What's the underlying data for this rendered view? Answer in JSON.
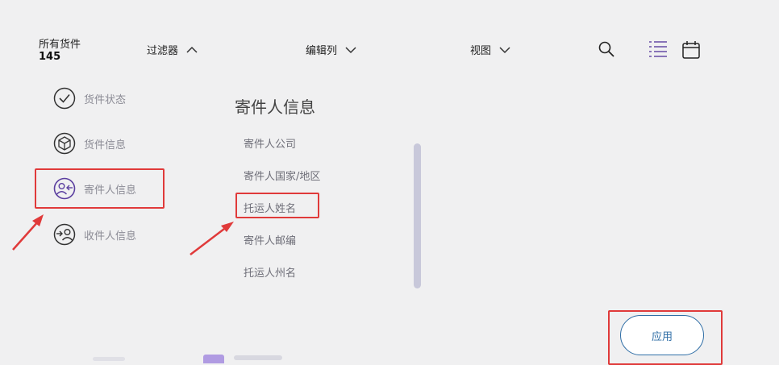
{
  "header": {
    "count_label": "所有货件",
    "count_value": "145",
    "filter_label": "过滤器",
    "edit_columns_label": "编辑列",
    "view_label": "视图"
  },
  "categories": [
    {
      "label": "货件状态",
      "icon": "check-circle-icon"
    },
    {
      "label": "货件信息",
      "icon": "box-icon"
    },
    {
      "label": "寄件人信息",
      "icon": "sender-user-icon"
    },
    {
      "label": "收件人信息",
      "icon": "recipient-user-icon"
    }
  ],
  "panel": {
    "title": "寄件人信息",
    "fields": [
      "寄件人公司",
      "寄件人国家/地区",
      "托运人姓名",
      "寄件人邮编",
      "托运人州名"
    ]
  },
  "apply_label": "应用",
  "colors": {
    "highlight": "#e03a3a",
    "accent_purple": "#5b3fa0",
    "apply_blue": "#2f6ea6"
  }
}
